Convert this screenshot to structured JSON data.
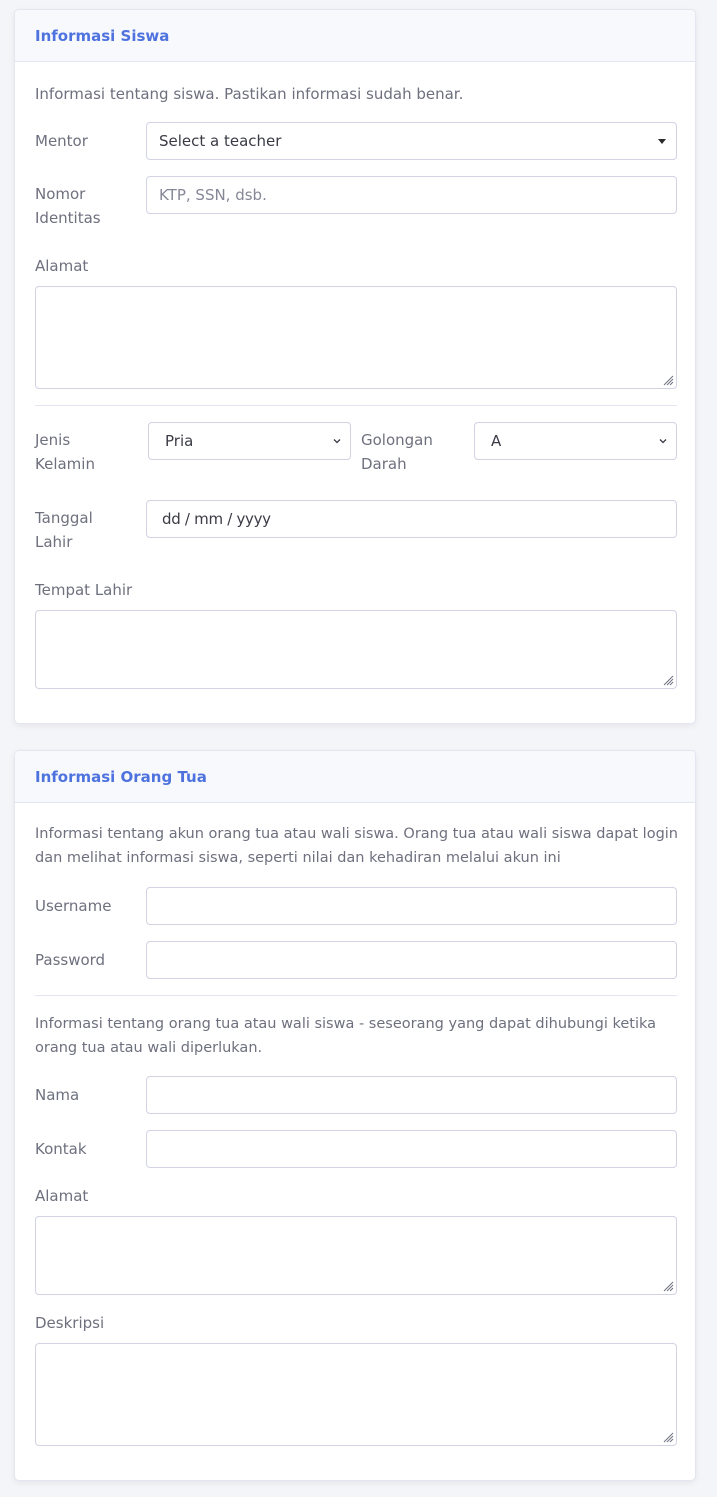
{
  "siswa": {
    "title": "Informasi Siswa",
    "help": "Informasi tentang siswa. Pastikan informasi sudah benar.",
    "mentor_label": "Mentor",
    "mentor_value": "Select a teacher",
    "nomor_label_1": "Nomor",
    "nomor_label_2": "Identitas",
    "nomor_placeholder": "KTP, SSN, dsb.",
    "alamat_label": "Alamat",
    "jk_label_1": "Jenis",
    "jk_label_2": "Kelamin",
    "jk_value": "Pria",
    "goldar_label_1": "Golongan",
    "goldar_label_2": "Darah",
    "goldar_value": "A",
    "tgl_label_1": "Tanggal",
    "tgl_label_2": "Lahir",
    "tgl_value": "dd / mm / yyyy",
    "tempat_label": "Tempat Lahir"
  },
  "ortu": {
    "title": "Informasi Orang Tua",
    "help_1_line1": "Informasi tentang akun orang tua atau wali siswa. Orang tua atau wali siswa dapat login",
    "help_1_line2": "dan melihat informasi siswa, seperti nilai dan kehadiran melalui akun ini",
    "username_label": "Username",
    "password_label": "Password",
    "help_2_line1": "Informasi tentang orang tua atau wali siswa - seseorang yang dapat dihubungi ketika",
    "help_2_line2": "orang tua atau wali diperlukan.",
    "nama_label": "Nama",
    "kontak_label": "Kontak",
    "alamat_label": "Alamat",
    "deskripsi_label": "Deskripsi"
  },
  "colors": {
    "accent": "#4e73df",
    "text": "#6e707e",
    "border": "#d1d3e2",
    "header_bg": "#f8f9fc",
    "page_bg": "#f4f5f9"
  }
}
